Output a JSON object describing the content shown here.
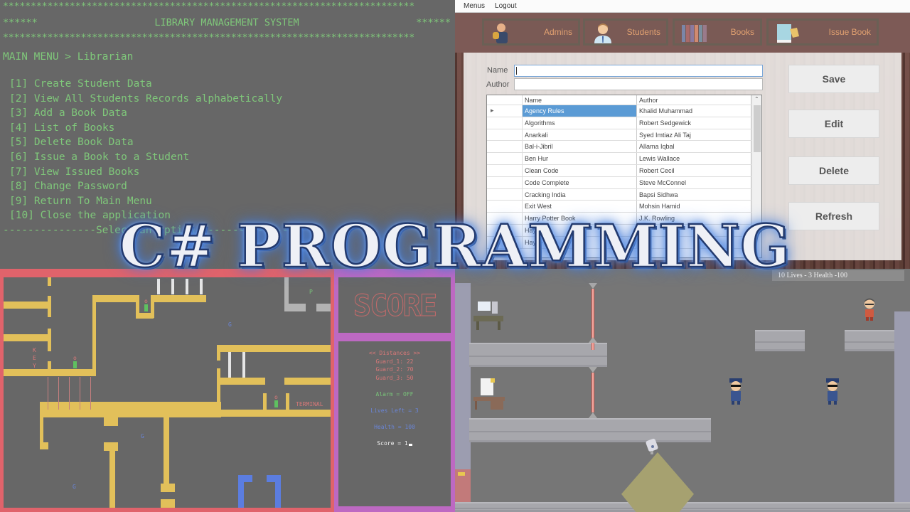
{
  "title_overlay": "C# PROGRAMMING",
  "console_app": {
    "stars_line": "**************************************************************************",
    "side_stars": "******",
    "title": "LIBRARY MANAGEMENT SYSTEM",
    "breadcrumb": "MAIN MENU > Librarian",
    "menu_items": [
      "[1] Create Student Data",
      "[2] View All Students Records alphabetically",
      "[3] Add a Book Data",
      "[4] List of Books",
      "[5] Delete Book Data",
      "[6] Issue a Book to a Student",
      "[7] View Issued Books",
      "[8] Change Password",
      "[9] Return To Main Menu",
      "[10] Close the application"
    ],
    "prompt_line": "---------------Select an option---------------"
  },
  "winforms_app": {
    "menubar": [
      "Menus",
      "Logout"
    ],
    "nav_buttons": [
      {
        "label": "Admins",
        "icon": "admin-icon"
      },
      {
        "label": "Students",
        "icon": "student-icon"
      },
      {
        "label": "Books",
        "icon": "books-icon"
      },
      {
        "label": "Issue Book",
        "icon": "issue-book-icon"
      }
    ],
    "form": {
      "name_label": "Name",
      "name_value": "",
      "author_label": "Author",
      "author_value": ""
    },
    "grid": {
      "columns": [
        "Name",
        "Author"
      ],
      "selected_row": 0,
      "rows": [
        [
          "Agency Rules",
          "Khalid Muhammad"
        ],
        [
          "Algorithms",
          "Robert Sedgewick"
        ],
        [
          "Anarkali",
          "Syed Imtiaz Ali Taj"
        ],
        [
          "Bal-i-Jibril",
          "Allama Iqbal"
        ],
        [
          "Ben Hur",
          "Lewis Wallace"
        ],
        [
          "Clean Code",
          "Robert Cecil"
        ],
        [
          "Code Complete",
          "Steve McConnel"
        ],
        [
          "Cracking India",
          "Bapsi Sidhwa"
        ],
        [
          "Exit West",
          "Mohsin Hamid"
        ],
        [
          "Harry Potter Book",
          "J.K. Rowling"
        ],
        [
          "Hayat-e...",
          ""
        ],
        [
          "Hayat-e...",
          ""
        ]
      ]
    },
    "actions": [
      "Save",
      "Edit",
      "Delete",
      "Refresh"
    ]
  },
  "ascii_game": {
    "key_label": [
      "K",
      "E",
      "Y"
    ],
    "terminal_label": "TERMINAL",
    "player_char": "P",
    "guard_char": "G",
    "door_char": "o",
    "score_banner": "SCORE",
    "stats": {
      "distances_header": "<< Distances >>",
      "guards": [
        "Guard_1: 22",
        "Guard_2: 70",
        "Guard_3: 50"
      ],
      "alarm": "Alarm = OFF",
      "lives": "Lives Left = 3",
      "health": "Health = 100",
      "score": "Score = 1"
    }
  },
  "stealth_game": {
    "hud": "10   Lives - 3    Health -100"
  }
}
